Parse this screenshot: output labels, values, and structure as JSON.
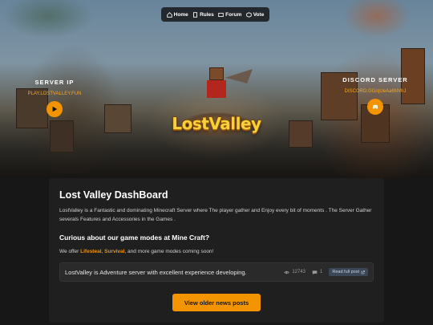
{
  "nav": {
    "items": [
      {
        "label": "Home",
        "icon": "home-icon"
      },
      {
        "label": "Rules",
        "icon": "book-icon"
      },
      {
        "label": "Forum",
        "icon": "forum-icon"
      },
      {
        "label": "Vote",
        "icon": "cube-icon"
      }
    ]
  },
  "server": {
    "title": "SERVER IP",
    "value": "PLAY.LOSTVALLEY.FUN",
    "button_icon": "play-icon"
  },
  "discord": {
    "title": "DISCORD SERVER",
    "value": "DISCORD.GG/qUeAa6NVhJ",
    "button_icon": "discord-icon"
  },
  "logo": {
    "text": "LostValley"
  },
  "card": {
    "title": "Lost Valley DashBoard",
    "description": "LostValley is a Fantastic and dominating Minecraft Server where The player gather and Enjoy every bit of moments . The Server Gather severals Features and Accessories in the Games .",
    "subtitle": "Curious about our game modes at Mine Craft?",
    "modes_prefix": "We offer ",
    "mode1": "Lifesteal",
    "sep1": ", ",
    "mode2": "Survival",
    "modes_suffix": ", and more game modes coming soon!"
  },
  "post": {
    "text": "LostValley is Adventure server with excellent experience developing.",
    "views": "12743",
    "comments": "1",
    "read_label": "Read full post"
  },
  "older_button": "View older news posts",
  "colors": {
    "accent": "#f29300",
    "card_bg": "#1f1f1f",
    "page_bg": "#171717"
  }
}
